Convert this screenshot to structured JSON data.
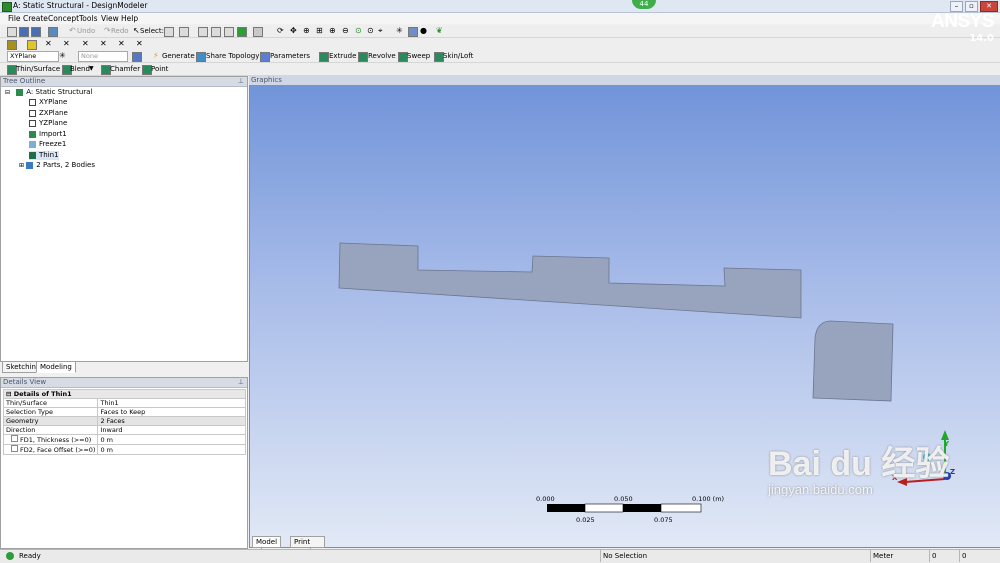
{
  "window": {
    "title": "A: Static Structural - DesignModeler",
    "badge": "44"
  },
  "menu": [
    "File",
    "Create",
    "Concept",
    "Tools",
    "View",
    "Help"
  ],
  "toolbar1": {
    "undo": "Undo",
    "redo": "Redo",
    "select": "Select:"
  },
  "toolbar3": {
    "plane": "XYPlane",
    "sketch": "None",
    "generate": "Generate",
    "share_topology": "Share Topology",
    "parameters": "Parameters",
    "extrude": "Extrude",
    "revolve": "Revolve",
    "sweep": "Sweep",
    "skin_loft": "Skin/Loft"
  },
  "toolbar4": {
    "thin_surface": "Thin/Surface",
    "blend": "Blend",
    "chamfer": "Chamfer",
    "point": "Point"
  },
  "tree": {
    "title": "Tree Outline",
    "root": "A: Static Structural",
    "items": [
      "XYPlane",
      "ZXPlane",
      "YZPlane",
      "Import1",
      "Freeze1",
      "Thin1",
      "2 Parts, 2 Bodies"
    ]
  },
  "tabs": {
    "sketching": "Sketching",
    "modeling": "Modeling"
  },
  "details": {
    "title": "Details View",
    "group": "Details of Thin1",
    "rows": [
      {
        "k": "Thin/Surface",
        "v": "Thin1"
      },
      {
        "k": "Selection Type",
        "v": "Faces to Keep"
      },
      {
        "k": "Geometry",
        "v": "2 Faces"
      },
      {
        "k": "Direction",
        "v": "Inward"
      },
      {
        "k": "FD1, Thickness (>=0)",
        "v": "0 m"
      },
      {
        "k": "FD2, Face Offset (>=0)",
        "v": "0 m"
      }
    ]
  },
  "graphics": {
    "title": "Graphics",
    "logo": "ANSYS",
    "version": "14.0",
    "scale_top": [
      "0.000",
      "0.050",
      "0.100 (m)"
    ],
    "scale_bottom": [
      "0.025",
      "0.075"
    ],
    "triad": {
      "y": "Y",
      "x": "X",
      "z": "Z"
    },
    "view_tabs": [
      "Model View",
      "Print Preview"
    ]
  },
  "status": {
    "ready": "Ready",
    "selection": "No Selection",
    "unit": "Meter",
    "v1": "0",
    "v2": "0"
  },
  "watermark": {
    "text": "Bai du 经验",
    "url": "jingyan.baidu.com"
  },
  "colors": {
    "gfx_top": "#6f92d8",
    "gfx_bottom": "#e2e9f6",
    "body": "#98a3bd",
    "triad_y": "#1fa82a",
    "triad_x": "#b82020",
    "triad_z": "#1c39b8"
  }
}
